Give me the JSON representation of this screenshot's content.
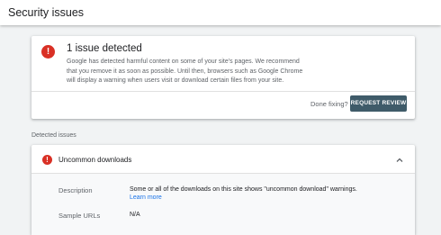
{
  "header": {
    "title": "Security issues"
  },
  "summary": {
    "icon": "alert-icon",
    "icon_glyph": "!",
    "title": "1 issue detected",
    "description_lines": [
      "Google has detected harmful content on some of your site's pages. We recommend",
      "that you remove it as soon as possible. Until then, browsers such as Google Chrome",
      "will display a warning when users visit or download certain files from your site."
    ],
    "done_fixing": "Done fixing?",
    "request_review_label": "REQUEST REVIEW"
  },
  "detected": {
    "label": "Detected issues",
    "issues": [
      {
        "icon": "alert-icon",
        "icon_glyph": "!",
        "title": "Uncommon downloads",
        "expanded": true,
        "description_label": "Description",
        "description_text": "Some or all of the downloads on this site shows \"uncommon download\" warnings.",
        "learn_more": "Learn more",
        "sample_urls_label": "Sample URLs",
        "sample_urls_value": "N/A"
      }
    ]
  },
  "colors": {
    "background": "#f1f3f4",
    "alert_red": "#d93025",
    "button": "#3f5b69",
    "link": "#1a73e8"
  }
}
